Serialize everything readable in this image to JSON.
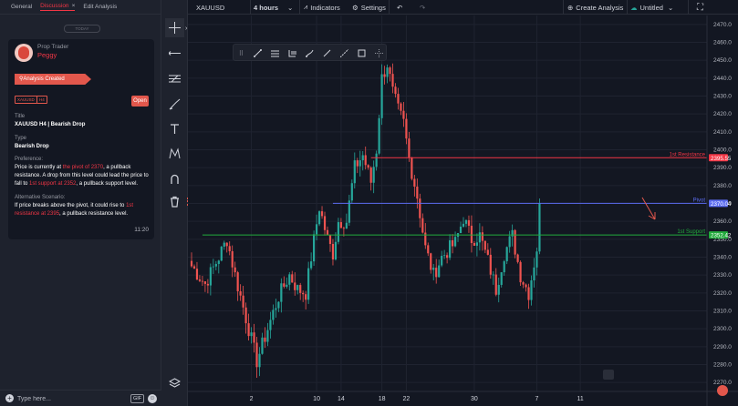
{
  "panel": {
    "tabs": [
      {
        "label": "General"
      },
      {
        "label": "Discussion",
        "close": "×"
      },
      {
        "label": "Edit Analysis"
      }
    ],
    "date_separator": "TODAY",
    "post": {
      "author_role": "Prop Trader",
      "author_name": "Peggy",
      "banner": "Analysis Created",
      "symbol_badge": "XAUUSD",
      "timeframe_badge": "H4",
      "open_button": "Open",
      "title_label": "Title",
      "title_value": "XAUUSD H4 | Bearish Drop",
      "type_label": "Type",
      "type_value": "Bearish Drop",
      "preference_label": "Preference:",
      "preference_text": {
        "p1": "Price is currently at ",
        "h1": "the pivot of 2370",
        "p2": ", a pullback resistance. A drop from this level could lead the price to fall to ",
        "h2": "1st support at 2352",
        "p3": ", a pullback support level."
      },
      "alt_label": "Alternative Scenario:",
      "alt_text": {
        "p1": "If price breaks above the pivot, it could rise to ",
        "h1": "1st resistance at 2395",
        "p2": ", a pullback resistance level."
      },
      "time": "11:20"
    },
    "composer": {
      "plus": "+",
      "placeholder": "Type here...",
      "gif": "GIF",
      "emoji": "☺"
    }
  },
  "topbar": {
    "symbol": "XAUUSD",
    "interval": "4 hours",
    "indicators": "Indicators",
    "settings": "Settings",
    "create_analysis": "Create Analysis",
    "layout_name": "Untitled"
  },
  "colors": {
    "up": "#26a69a",
    "down": "#ef5350",
    "resistance": "#f23645",
    "pivot": "#5b6cf0",
    "support": "#22ab3c",
    "accent": "#e2574c"
  },
  "chart_data": {
    "type": "candlestick",
    "symbol": "XAUUSD",
    "timeframe": "4 hours",
    "ylim": [
      2265,
      2475
    ],
    "y_ticks": [
      2270,
      2280,
      2290,
      2300,
      2310,
      2320,
      2330,
      2340,
      2350,
      2360,
      2370,
      2380,
      2390,
      2400,
      2410,
      2420,
      2430,
      2440,
      2450,
      2460,
      2470
    ],
    "x_ticks": [
      {
        "label": "2",
        "bar": 22
      },
      {
        "label": "10",
        "bar": 46
      },
      {
        "label": "14",
        "bar": 55
      },
      {
        "label": "18",
        "bar": 70
      },
      {
        "label": "22",
        "bar": 79
      },
      {
        "label": "30",
        "bar": 104
      },
      {
        "label": "7",
        "bar": 127
      },
      {
        "label": "11",
        "bar": 143
      }
    ],
    "levels": [
      {
        "name": "1st Resistance",
        "value": 2395.55,
        "role": "resistance",
        "from_bar": 66
      },
      {
        "name": "Pivot",
        "value": 2370.04,
        "role": "pivot",
        "from_bar": 52
      },
      {
        "name": "1st Support",
        "value": 2352.42,
        "role": "support",
        "from_bar": 4
      }
    ],
    "price_labels": [
      "2395.55",
      "2370.04",
      "2352.42"
    ],
    "level_texts": [
      "1st Resistance",
      "Pivot",
      "1st Support"
    ],
    "grid": true,
    "price_anchors": [
      [
        0,
        2335
      ],
      [
        5,
        2325
      ],
      [
        10,
        2340
      ],
      [
        13,
        2350
      ],
      [
        16,
        2330
      ],
      [
        21,
        2300
      ],
      [
        24,
        2282
      ],
      [
        28,
        2300
      ],
      [
        32,
        2318
      ],
      [
        36,
        2330
      ],
      [
        39,
        2322
      ],
      [
        42,
        2320
      ],
      [
        44,
        2340
      ],
      [
        47,
        2368
      ],
      [
        50,
        2350
      ],
      [
        52,
        2342
      ],
      [
        54,
        2360
      ],
      [
        57,
        2360
      ],
      [
        60,
        2390
      ],
      [
        63,
        2397
      ],
      [
        66,
        2382
      ],
      [
        68,
        2400
      ],
      [
        70,
        2440
      ],
      [
        72,
        2448
      ],
      [
        74,
        2432
      ],
      [
        76,
        2422
      ],
      [
        78,
        2415
      ],
      [
        80,
        2395
      ],
      [
        83,
        2374
      ],
      [
        86,
        2345
      ],
      [
        89,
        2330
      ],
      [
        92,
        2340
      ],
      [
        95,
        2345
      ],
      [
        97,
        2348
      ],
      [
        100,
        2362
      ],
      [
        103,
        2350
      ],
      [
        106,
        2352
      ],
      [
        109,
        2338
      ],
      [
        112,
        2322
      ],
      [
        115,
        2342
      ],
      [
        118,
        2352
      ],
      [
        121,
        2330
      ],
      [
        124,
        2320
      ],
      [
        127,
        2345
      ],
      [
        128,
        2370
      ]
    ]
  }
}
